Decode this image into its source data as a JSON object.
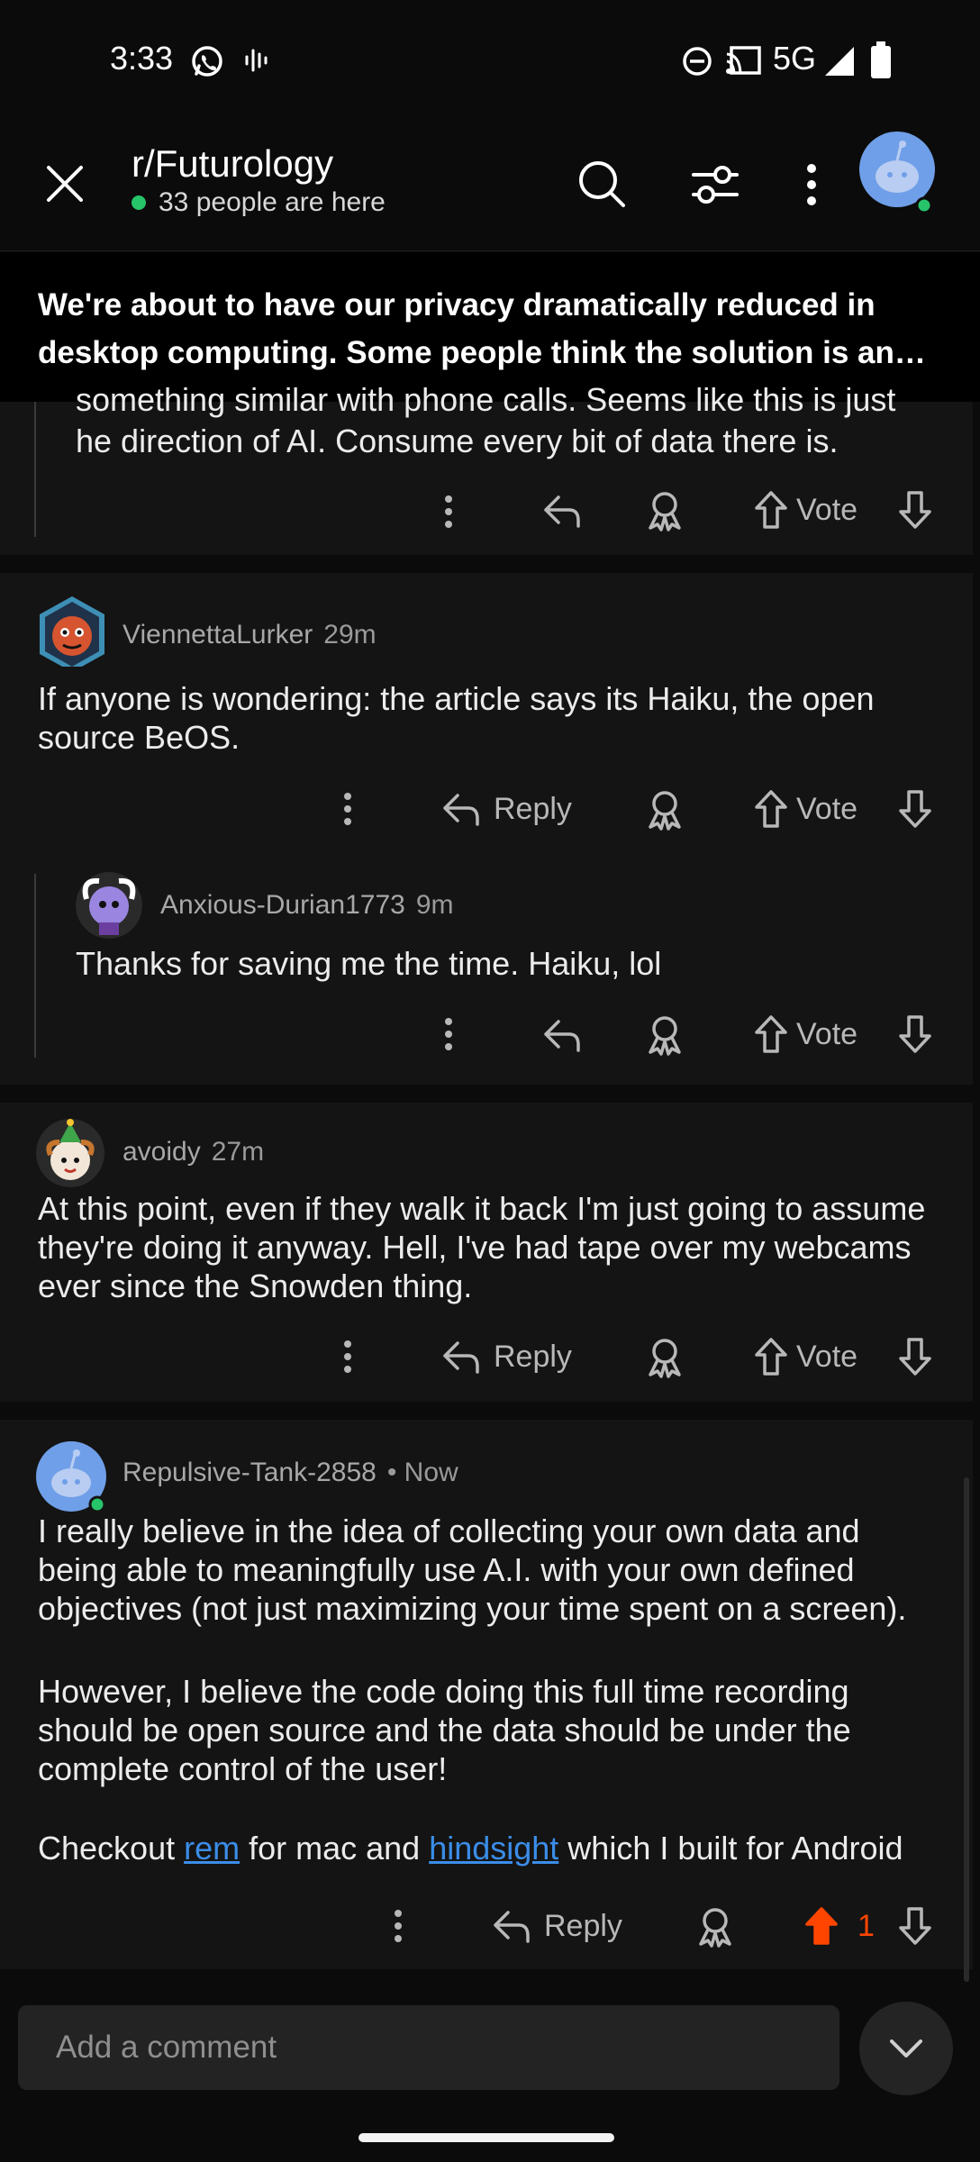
{
  "status_bar": {
    "time": "3:33",
    "network": "5G",
    "icons": [
      "whatsapp-icon",
      "voice-icon",
      "dnd-icon",
      "cast-icon",
      "signal-icon",
      "battery-icon"
    ]
  },
  "header": {
    "subreddit": "r/Futurology",
    "online_text": "33 people are here",
    "icons": [
      "close-icon",
      "search-icon",
      "filter-icon",
      "more-vert-icon",
      "avatar"
    ]
  },
  "post_title": "We're about to have our privacy dramatically reduced in desktop computing. Some people think the solution is an open-source alternative...",
  "comments": {
    "partial": {
      "text_line1": "something similar with phone calls. Seems like this is just",
      "text_line2": "he direction of AI. Consume every bit of data there is.",
      "vote_label": "Vote"
    },
    "c1": {
      "user": "ViennettaLurker",
      "age": "29m",
      "text": "If anyone is wondering: the article says its Haiku, the open source BeOS.",
      "reply_label": "Reply",
      "vote_label": "Vote"
    },
    "c1_reply": {
      "user": "Anxious-Durian1773",
      "age": "9m",
      "text": "Thanks for saving me the time. Haiku, lol",
      "vote_label": "Vote"
    },
    "c2": {
      "user": "avoidy",
      "age": "27m",
      "text": "At this point, even if they walk it back I'm just going to assume they're doing it anyway. Hell, I've had tape over my webcams ever since the Snowden thing.",
      "reply_label": "Reply",
      "vote_label": "Vote"
    },
    "c3": {
      "user": "Repulsive-Tank-2858",
      "age": "• Now",
      "para1": "I really believe in the idea of collecting your own data and being able to meaningfully use A.I. with your own defined objectives (not just maximizing your time spent on a screen).",
      "para2": "However, I believe the code doing this full time recording should be open source and the data should be under the complete control of the user!",
      "para3_prefix": "Checkout ",
      "link1": "rem",
      "para3_mid": " for mac and ",
      "link2": "hindsight",
      "para3_suffix": " which I built for Android",
      "reply_label": "Reply",
      "score": "1"
    }
  },
  "composer": {
    "placeholder": "Add a comment"
  },
  "colors": {
    "background": "#0b0b0b",
    "card": "#141414",
    "text": "#ececec",
    "muted": "#9a9a9a",
    "link": "#3b8de8",
    "upvote": "#ff4500",
    "online": "#27c46a"
  }
}
